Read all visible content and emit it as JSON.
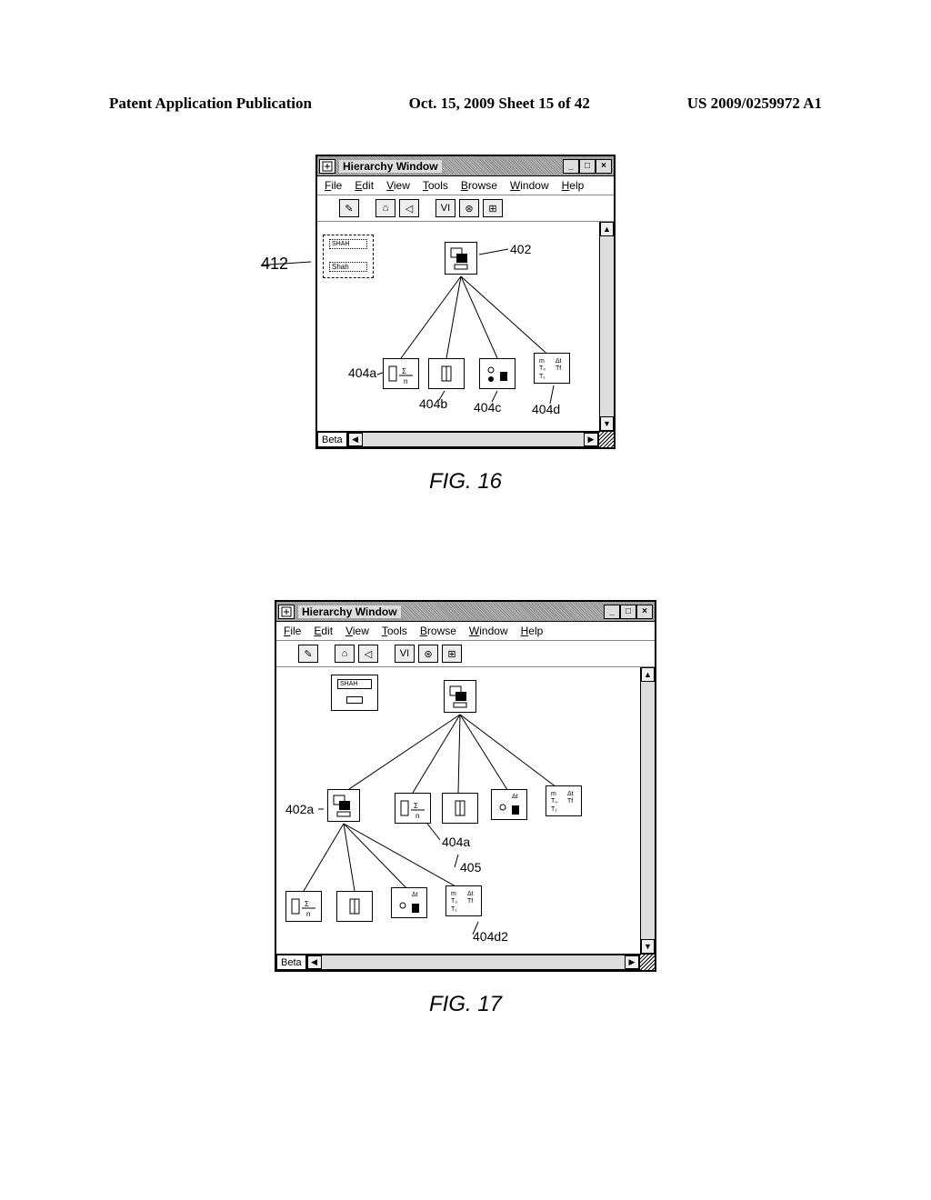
{
  "header": {
    "left": "Patent Application Publication",
    "mid": "Oct. 15, 2009  Sheet 15 of 42",
    "right": "US 2009/0259972 A1"
  },
  "figure16": {
    "label": "FIG. 16",
    "window_title": "Hierarchy Window",
    "menu": [
      "File",
      "Edit",
      "View",
      "Tools",
      "Browse",
      "Window",
      "Help"
    ],
    "tag_top": "SHAH",
    "tag_bottom": "Shah",
    "beta": "Beta",
    "refs": {
      "r412": "412",
      "r402": "402",
      "r404a": "404a",
      "r404b": "404b",
      "r404c": "404c",
      "r404d": "404d"
    }
  },
  "figure17": {
    "label": "FIG. 17",
    "window_title": "Hierarchy Window",
    "menu": [
      "File",
      "Edit",
      "View",
      "Tools",
      "Browse",
      "Window",
      "Help"
    ],
    "tag_top": "SHAH",
    "beta": "Beta",
    "refs": {
      "r402a": "402a",
      "r404a": "404a",
      "r405": "405",
      "r404d2": "404d2"
    }
  }
}
